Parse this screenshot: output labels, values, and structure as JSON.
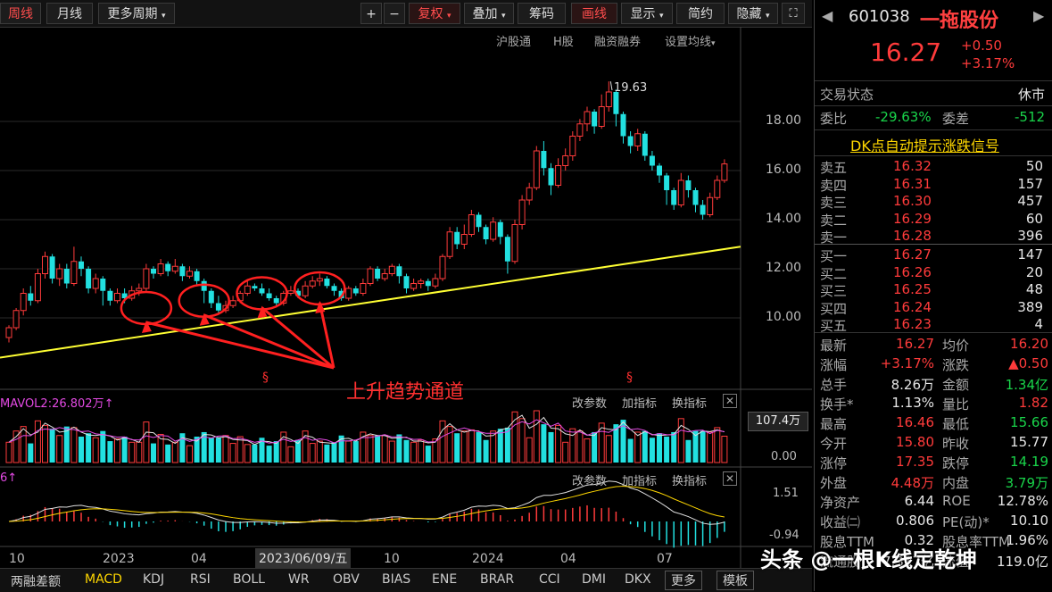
{
  "toolbar": {
    "left": [
      "周线",
      "月线",
      "更多周期"
    ],
    "right": [
      "+",
      "−",
      "复权",
      "叠加",
      "筹码",
      "画线",
      "显示",
      "简约",
      "隐藏"
    ]
  },
  "sub_toolbar": [
    "沪股通",
    "H股",
    "融资融券",
    "设置均线"
  ],
  "chart": {
    "price_labels": [
      "18.00",
      "16.00",
      "14.00",
      "12.00",
      "10.00"
    ],
    "price_values": [
      18,
      16,
      14,
      12,
      10
    ],
    "high_label": "19.63",
    "annotation": "上升趋势通道",
    "s_mark": "§",
    "x_labels": [
      "10",
      "2023",
      "04",
      "10",
      "2024",
      "04",
      "07"
    ],
    "cursor_date": "2023/06/09/五",
    "vol_label": "MAVOL2:26.802万",
    "vol_max": "107.4万",
    "vol_min": "0.00",
    "macd_label": "6",
    "macd_max": "1.51",
    "macd_min": "-0.94",
    "panel_links": [
      "改参数",
      "加指标",
      "换指标"
    ],
    "candles": [
      [
        9.2,
        9.6,
        9.0,
        9.7
      ],
      [
        9.6,
        10.3,
        9.5,
        10.4
      ],
      [
        10.3,
        11.0,
        10.1,
        11.2
      ],
      [
        11.0,
        10.7,
        10.5,
        11.3
      ],
      [
        10.7,
        11.8,
        10.6,
        12.0
      ],
      [
        11.8,
        12.5,
        11.6,
        12.7
      ],
      [
        12.5,
        11.6,
        11.4,
        12.6
      ],
      [
        11.6,
        12.0,
        11.3,
        12.2
      ],
      [
        12.0,
        11.4,
        11.2,
        12.2
      ],
      [
        11.4,
        12.3,
        11.3,
        12.9
      ],
      [
        12.3,
        12.0,
        11.7,
        12.5
      ],
      [
        12.0,
        11.2,
        11.0,
        12.1
      ],
      [
        11.2,
        11.6,
        11.0,
        11.8
      ],
      [
        11.6,
        11.1,
        10.5,
        11.7
      ],
      [
        11.1,
        10.7,
        10.5,
        11.2
      ],
      [
        10.7,
        11.0,
        10.6,
        11.2
      ],
      [
        11.0,
        10.8,
        10.6,
        11.2
      ],
      [
        10.8,
        11.1,
        10.7,
        11.3
      ],
      [
        11.1,
        11.2,
        10.9,
        11.4
      ],
      [
        11.2,
        12.0,
        11.1,
        12.2
      ],
      [
        12.0,
        11.8,
        11.6,
        12.1
      ],
      [
        11.8,
        12.2,
        11.7,
        12.4
      ],
      [
        12.2,
        11.9,
        11.7,
        12.3
      ],
      [
        11.9,
        12.1,
        11.8,
        12.4
      ],
      [
        12.1,
        11.7,
        11.5,
        12.2
      ],
      [
        11.7,
        11.9,
        11.6,
        12.1
      ],
      [
        11.9,
        11.5,
        11.3,
        12.0
      ],
      [
        11.5,
        11.1,
        10.6,
        11.6
      ],
      [
        11.1,
        10.6,
        10.4,
        11.2
      ],
      [
        10.6,
        10.3,
        10.2,
        10.9
      ],
      [
        10.3,
        10.5,
        10.2,
        10.7
      ],
      [
        10.5,
        10.7,
        10.4,
        10.9
      ],
      [
        10.7,
        11.0,
        10.6,
        11.1
      ],
      [
        11.0,
        11.3,
        10.9,
        11.5
      ],
      [
        11.3,
        11.2,
        11.1,
        11.4
      ],
      [
        11.2,
        11.0,
        10.9,
        11.4
      ],
      [
        11.0,
        10.8,
        10.7,
        11.2
      ],
      [
        10.8,
        10.6,
        10.5,
        10.9
      ],
      [
        10.6,
        11.0,
        10.5,
        11.1
      ],
      [
        11.0,
        11.1,
        10.9,
        11.3
      ],
      [
        11.1,
        10.9,
        10.8,
        11.2
      ],
      [
        10.9,
        11.3,
        10.8,
        11.5
      ],
      [
        11.3,
        11.5,
        11.2,
        11.7
      ],
      [
        11.5,
        11.6,
        11.3,
        11.8
      ],
      [
        11.6,
        11.3,
        11.2,
        11.7
      ],
      [
        11.3,
        11.1,
        10.9,
        11.4
      ],
      [
        11.1,
        10.8,
        10.7,
        11.2
      ],
      [
        10.8,
        11.2,
        10.7,
        11.3
      ],
      [
        11.2,
        11.0,
        10.9,
        11.3
      ],
      [
        11.0,
        11.4,
        10.9,
        11.6
      ],
      [
        11.4,
        12.0,
        11.3,
        12.1
      ],
      [
        12.0,
        11.6,
        11.5,
        12.1
      ],
      [
        11.6,
        11.8,
        11.5,
        12.0
      ],
      [
        11.8,
        12.1,
        11.7,
        12.2
      ],
      [
        12.1,
        11.7,
        11.4,
        12.2
      ],
      [
        11.7,
        11.2,
        11.0,
        11.8
      ],
      [
        11.2,
        11.4,
        11.1,
        11.6
      ],
      [
        11.4,
        11.5,
        11.2,
        11.6
      ],
      [
        11.5,
        11.3,
        11.1,
        11.6
      ],
      [
        11.3,
        11.6,
        11.2,
        11.8
      ],
      [
        11.6,
        12.5,
        11.5,
        12.6
      ],
      [
        12.5,
        13.5,
        12.4,
        13.7
      ],
      [
        13.5,
        13.0,
        12.8,
        13.7
      ],
      [
        13.0,
        13.4,
        12.8,
        13.8
      ],
      [
        13.4,
        14.2,
        13.3,
        14.4
      ],
      [
        14.2,
        13.7,
        13.5,
        14.3
      ],
      [
        13.7,
        13.2,
        13.0,
        13.8
      ],
      [
        13.2,
        13.9,
        13.1,
        14.1
      ],
      [
        13.9,
        13.3,
        13.0,
        14.0
      ],
      [
        13.3,
        12.3,
        11.8,
        13.4
      ],
      [
        12.3,
        13.8,
        12.2,
        14.0
      ],
      [
        13.8,
        14.8,
        13.6,
        15.0
      ],
      [
        14.8,
        15.3,
        14.6,
        15.5
      ],
      [
        15.3,
        16.8,
        15.2,
        17.0
      ],
      [
        16.8,
        16.1,
        15.8,
        17.2
      ],
      [
        16.1,
        15.4,
        15.0,
        16.3
      ],
      [
        15.4,
        16.2,
        15.3,
        16.5
      ],
      [
        16.2,
        16.6,
        16.0,
        16.9
      ],
      [
        16.6,
        17.4,
        16.4,
        17.6
      ],
      [
        17.4,
        17.9,
        17.2,
        18.1
      ],
      [
        17.9,
        18.4,
        17.6,
        18.6
      ],
      [
        18.4,
        17.8,
        17.5,
        18.5
      ],
      [
        17.8,
        18.6,
        17.7,
        19.1
      ],
      [
        18.6,
        19.2,
        18.4,
        19.63
      ],
      [
        19.2,
        18.3,
        17.8,
        19.3
      ],
      [
        18.3,
        17.4,
        17.1,
        18.4
      ],
      [
        17.4,
        17.0,
        16.7,
        17.6
      ],
      [
        17.0,
        17.5,
        16.8,
        17.7
      ],
      [
        17.5,
        16.6,
        16.4,
        17.6
      ],
      [
        16.6,
        16.2,
        16.0,
        16.8
      ],
      [
        16.2,
        15.8,
        15.5,
        16.3
      ],
      [
        15.8,
        15.2,
        14.6,
        15.9
      ],
      [
        15.2,
        14.6,
        14.4,
        15.3
      ],
      [
        14.6,
        15.6,
        14.5,
        15.9
      ],
      [
        15.6,
        15.2,
        14.9,
        15.8
      ],
      [
        15.2,
        14.6,
        14.3,
        15.3
      ],
      [
        14.6,
        14.2,
        14.0,
        14.8
      ],
      [
        14.2,
        14.9,
        14.1,
        15.1
      ],
      [
        14.9,
        15.6,
        14.8,
        15.8
      ],
      [
        15.6,
        16.27,
        15.5,
        16.46
      ]
    ],
    "trend": [
      [
        0,
        9.4
      ],
      [
        99,
        12.9
      ]
    ],
    "circles": [
      [
        19,
        10.4
      ],
      [
        27,
        10.7
      ],
      [
        35,
        11.0
      ],
      [
        43,
        11.2
      ]
    ]
  },
  "panel": {
    "code": "601038",
    "name": "一拖股份",
    "price": "16.27",
    "change": "+0.50",
    "pct": "+3.17%",
    "status_label": "交易状态",
    "status_value": "休市",
    "wb_label": "委比",
    "wb_value": "-29.63%",
    "wc_label": "委差",
    "wc_value": "-512",
    "signal": "DK点自动提示涨跌信号",
    "asks": [
      {
        "label": "卖五",
        "price": "16.32",
        "vol": "50"
      },
      {
        "label": "卖四",
        "price": "16.31",
        "vol": "157"
      },
      {
        "label": "卖三",
        "price": "16.30",
        "vol": "457"
      },
      {
        "label": "卖二",
        "price": "16.29",
        "vol": "60"
      },
      {
        "label": "卖一",
        "price": "16.28",
        "vol": "396"
      }
    ],
    "bids": [
      {
        "label": "买一",
        "price": "16.27",
        "vol": "147"
      },
      {
        "label": "买二",
        "price": "16.26",
        "vol": "20"
      },
      {
        "label": "买三",
        "price": "16.25",
        "vol": "48"
      },
      {
        "label": "买四",
        "price": "16.24",
        "vol": "389"
      },
      {
        "label": "买五",
        "price": "16.23",
        "vol": "4"
      }
    ],
    "stats": [
      [
        "最新",
        "16.27",
        "red",
        "均价",
        "16.20",
        "red"
      ],
      [
        "涨幅",
        "+3.17%",
        "red",
        "涨跌",
        "▲0.50",
        "red"
      ],
      [
        "总手",
        "8.26万",
        "white",
        "金额",
        "1.34亿",
        "green"
      ],
      [
        "换手*",
        "1.13%",
        "white",
        "量比",
        "1.82",
        "red"
      ],
      [
        "最高",
        "16.46",
        "red",
        "最低",
        "15.66",
        "green"
      ],
      [
        "今开",
        "15.80",
        "red",
        "昨收",
        "15.77",
        "white"
      ],
      [
        "涨停",
        "17.35",
        "red",
        "跌停",
        "14.19",
        "green"
      ],
      [
        "外盘",
        "4.48万",
        "red",
        "内盘",
        "3.79万",
        "green"
      ],
      [
        "净资产",
        "6.44",
        "white",
        "ROE",
        "12.78%",
        "white"
      ],
      [
        "收益㈡",
        "0.806",
        "white",
        "PE(动)*",
        "10.10",
        "white"
      ],
      [
        "股息TTM",
        "0.32",
        "white",
        "股息率TTM",
        "1.96%",
        "white"
      ],
      [
        "流通股",
        "7.317亿",
        "white",
        "流值",
        "119.0亿",
        "white"
      ]
    ]
  },
  "tabs": [
    "两融差额",
    "MACD",
    "KDJ",
    "RSI",
    "BOLL",
    "WR",
    "OBV",
    "BIAS",
    "ENE",
    "BRAR",
    "CCI",
    "DMI",
    "DKX",
    "更多",
    "模板"
  ],
  "watermark": "头条 @一根K线定乾坤"
}
